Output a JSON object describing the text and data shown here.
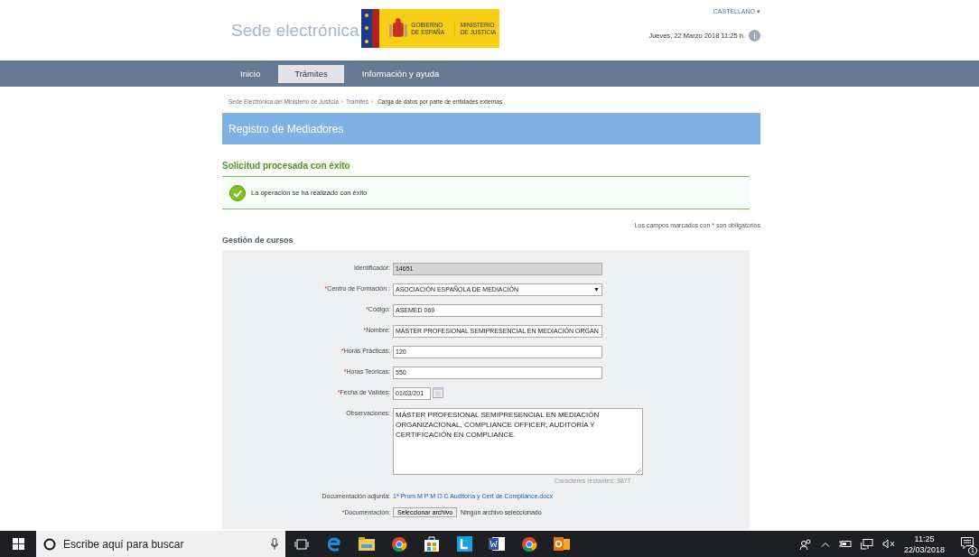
{
  "header": {
    "site_title": "Sede electrónica",
    "logo_texts": [
      "GOBIERNO DE ESPAÑA",
      "MINISTERIO DE JUSTICIA"
    ],
    "language": "CASTELLANO ▾",
    "datetime": "Jueves, 22 Marzo 2018   11:25 h.",
    "info_icon": "i"
  },
  "nav": [
    {
      "label": "Inicio",
      "selected": false
    },
    {
      "label": "Trámites",
      "selected": true
    },
    {
      "label": "Información y ayuda",
      "selected": false
    }
  ],
  "breadcrumb": {
    "links": [
      "Sede Electrónica del Ministerio de Justicia",
      "Trámites"
    ],
    "separator": "›",
    "current": "Carga de datos por parte de entidades externas"
  },
  "page_title": "Registro de Mediadores",
  "success": {
    "heading": "Solicitud procesada con éxito",
    "message": "La operación se ha realizado con éxito"
  },
  "required_note": {
    "before": "Los campos marcados con",
    "mark": "*",
    "after": "son obligatorios"
  },
  "section_title": "Gestión de cursos",
  "fields": [
    {
      "kind": "readonly",
      "label": "Identificador:",
      "required": false,
      "value": "14651"
    },
    {
      "kind": "select",
      "label": "Centro de Formación :",
      "required": true,
      "value": "ASOCIACIÓN ESPAÑOLA DE MEDIACIÓN",
      "caret": "▼"
    },
    {
      "kind": "text",
      "label": "Código:",
      "required": true,
      "value": "ASEMED 069"
    },
    {
      "kind": "text",
      "label": "Nombre:",
      "required": true,
      "value": "MÁSTER PROFESIONAL SEMIPRESENCIAL EN MEDIACIÓN ORGAN"
    },
    {
      "kind": "text",
      "label": "Horas Prácticas:",
      "required": true,
      "value": "120"
    },
    {
      "kind": "text",
      "label": "Horas Teóricas:",
      "required": true,
      "value": "550"
    },
    {
      "kind": "date",
      "label": "Fecha de Valides:",
      "required": true,
      "value": "01/03/201"
    },
    {
      "kind": "textarea",
      "label": "Observaciones:",
      "required": false,
      "value": "MÁSTER PROFESIONAL SEMIPRESENCIAL EN MEDIACIÓN ORGANIZACIONAL, COMPLIANCE OFFICER, AUDITORÍA Y CERTIFICACIÓN EN COMPLIANCE.",
      "counter": "Caracteres restantes: 3877"
    },
    {
      "kind": "link",
      "label": "Documentación adjunta:",
      "required": false,
      "value": "1ª Prom M P M O C Auditoría y Cert de Compliance.docx"
    },
    {
      "kind": "file",
      "label": "Documentación:",
      "required": true,
      "button": "Seleccionar archivo",
      "value": "Ningún archivo seleccionado"
    }
  ],
  "taskbar": {
    "search_placeholder": "Escribe aquí para buscar",
    "time": "11:25",
    "date": "22/03/2018",
    "notification_count": "1"
  }
}
